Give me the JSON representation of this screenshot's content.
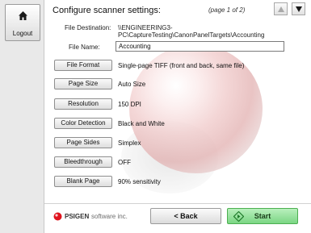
{
  "sidebar": {
    "logout_label": "Logout"
  },
  "header": {
    "title": "Configure scanner settings:",
    "page_indicator": "(page 1 of 2)"
  },
  "destination": {
    "label": "File Destination:",
    "value": "\\\\ENGINEERING3-PC\\CaptureTesting\\CanonPanelTargets\\Accounting"
  },
  "file_name": {
    "label": "File Name:",
    "value": "Accounting"
  },
  "settings": [
    {
      "button": "File Format",
      "value": "Single-page TIFF (front and back, same file)"
    },
    {
      "button": "Page Size",
      "value": "Auto Size"
    },
    {
      "button": "Resolution",
      "value": "150 DPI"
    },
    {
      "button": "Color Detection",
      "value": "Black and White"
    },
    {
      "button": "Page Sides",
      "value": "Simplex"
    },
    {
      "button": "Bleedthrough",
      "value": "OFF"
    },
    {
      "button": "Blank Page",
      "value": "90% sensitivity"
    }
  ],
  "footer": {
    "brand": "PSIGEN",
    "brand_sub": "software inc.",
    "back_label": "< Back",
    "start_label": "Start"
  },
  "colors": {
    "start_green": "#7bd684",
    "logo_red": "#e0141e",
    "ball_pink": "#f0c9c9"
  },
  "icons": {
    "logout": "house-icon",
    "nav_up": "arrow-up-icon",
    "nav_down": "arrow-down-icon",
    "start": "start-diamond-icon"
  }
}
